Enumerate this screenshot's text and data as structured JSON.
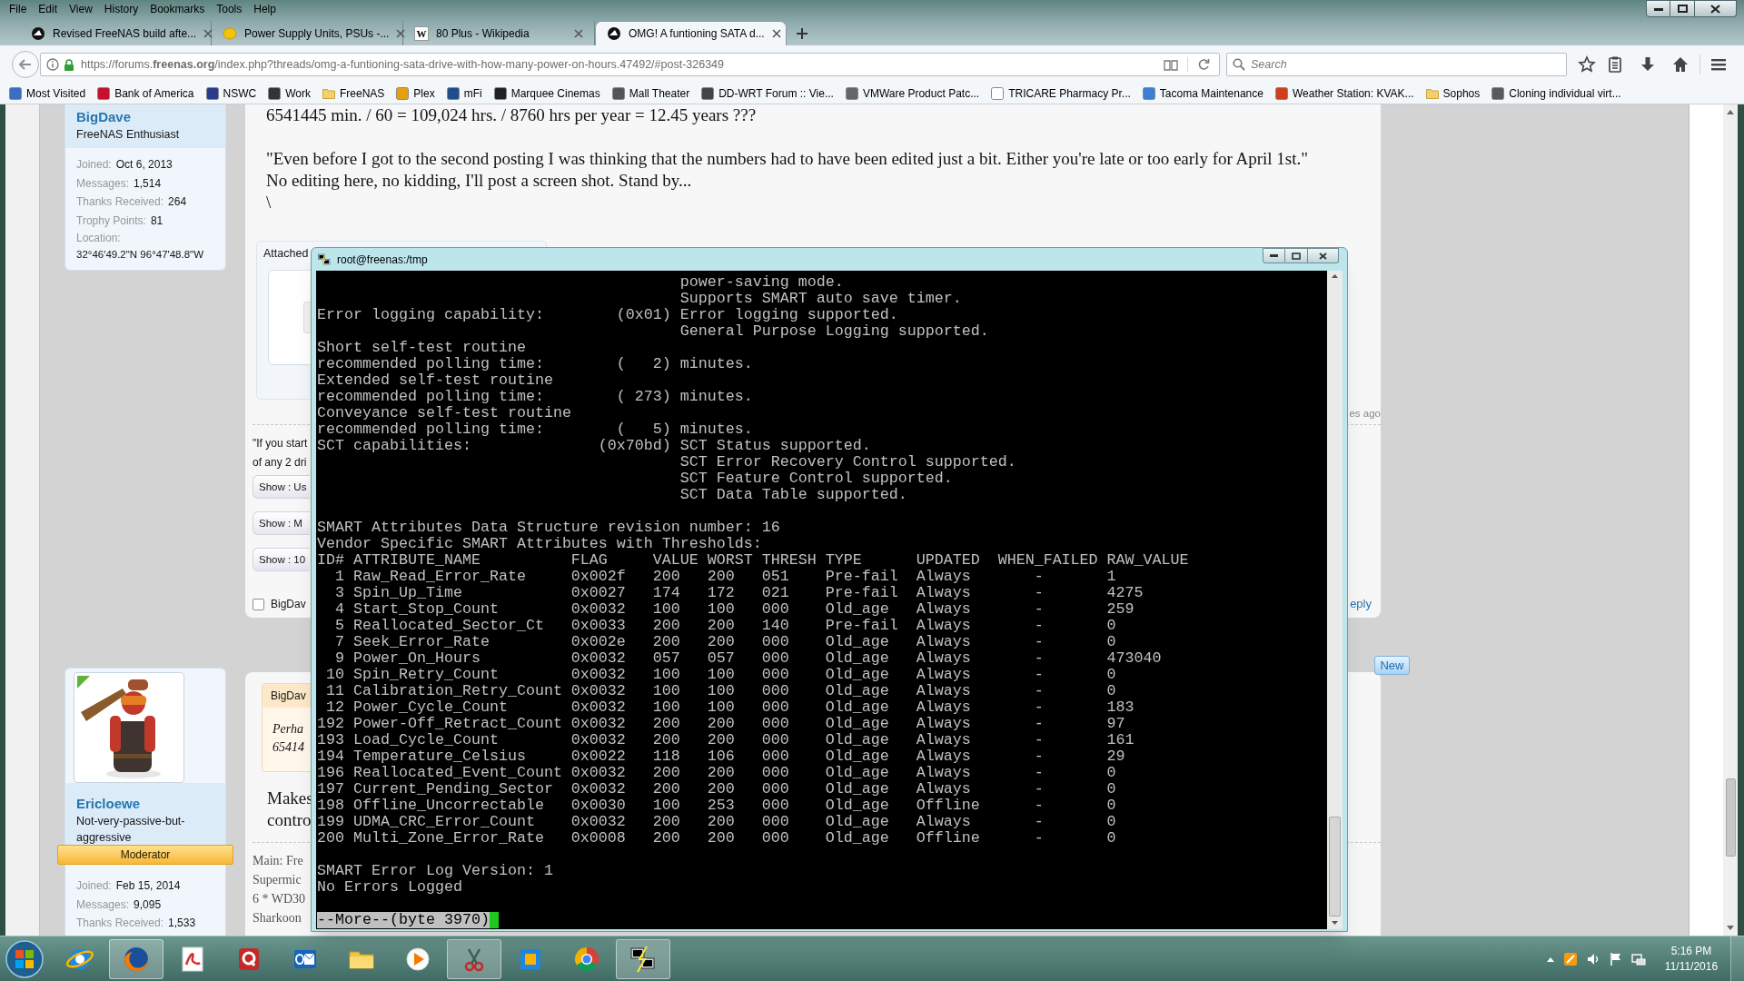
{
  "menu_bar": [
    "File",
    "Edit",
    "View",
    "History",
    "Bookmarks",
    "Tools",
    "Help"
  ],
  "tabs": [
    {
      "title": "Revised FreeNAS build afte...",
      "kind": "freenas",
      "selected": false
    },
    {
      "title": "Power Supply Units, PSUs -...",
      "kind": "coin",
      "selected": false
    },
    {
      "title": "80 Plus - Wikipedia",
      "kind": "letter",
      "icon_text": "W",
      "selected": false
    },
    {
      "title": "OMG! A funtioning SATA d...",
      "kind": "freenas",
      "selected": true
    }
  ],
  "address_bar": {
    "url": "https://forums.**freenas.org**/index.php?threads/omg-a-funtioning-sata-drive-with-how-many-power-on-hours.47492/#post-326349"
  },
  "search_field": {
    "placeholder": "Search"
  },
  "bookmarks": [
    {
      "label": "Most Visited",
      "kind": "tile",
      "color": "#3b6fc4"
    },
    {
      "label": "Bank of America",
      "kind": "tile",
      "color": "#c8102e"
    },
    {
      "label": "NSWC",
      "kind": "tile",
      "color": "#2a3a8c"
    },
    {
      "label": "Work",
      "kind": "tile",
      "color": "#333333"
    },
    {
      "label": "FreeNAS",
      "kind": "folder"
    },
    {
      "label": "Plex",
      "kind": "tile",
      "color": "#e5a00d"
    },
    {
      "label": "mFi",
      "kind": "tile",
      "color": "#1f4e8c"
    },
    {
      "label": "Marquee Cinemas",
      "kind": "tile",
      "color": "#222222"
    },
    {
      "label": "Mall Theater",
      "kind": "tile",
      "color": "#555555"
    },
    {
      "label": "DD-WRT Forum :: Vie...",
      "kind": "tile",
      "color": "#444444"
    },
    {
      "label": "VMWare Product Patc...",
      "kind": "tile",
      "color": "#666666"
    },
    {
      "label": "TRICARE Pharmacy Pr...",
      "kind": "tile",
      "color": "#ffffff"
    },
    {
      "label": "Tacoma Maintenance",
      "kind": "tile",
      "color": "#3a7fd5"
    },
    {
      "label": "Weather Station: KVAK...",
      "kind": "tile",
      "color": "#d13f1a"
    },
    {
      "label": "Sophos",
      "kind": "folder"
    },
    {
      "label": "Cloning individual virt...",
      "kind": "tile",
      "color": "#5a5a5a"
    }
  ],
  "posts": [
    {
      "author": {
        "name": "BigDave",
        "title": "FreeNAS Enthusiast",
        "stats": [
          {
            "label": "Joined:",
            "value": "Oct 6, 2013"
          },
          {
            "label": "Messages:",
            "value": "1,514"
          },
          {
            "label": "Thanks Received:",
            "value": "264"
          },
          {
            "label": "Trophy Points:",
            "value": "81"
          }
        ],
        "location": {
          "label": "Location:",
          "value": "32°46'49.2\"N 96°47'48.8\"W"
        }
      },
      "body": [
        "6541445 min. / 60 = 109,024 hrs. / 8760 hrs per year = 12.45 years ???",
        "\"Even before I got to the second posting I was thinking that the numbers had to have been edited just a bit. Either you're late or too early for April 1st.\"",
        "No editing here, no kidding, I'll post a screen shot. Stand by...",
        "\\"
      ],
      "attachments_label": "Attached",
      "time": "es ago",
      "signature": [
        "\"If you start",
        "of any 2 dri"
      ],
      "spoiler_buttons": [
        "Show : Us",
        "Show : M",
        "Show : 10"
      ],
      "like_checkbox": {
        "label": "BigDav",
        "checked": false
      },
      "reply": "eply"
    },
    {
      "author": {
        "name": "Ericloewe",
        "title": "Not-very-passive-but-aggressive",
        "avatar": {
          "kind": "picture",
          "online": true
        },
        "banner": "Moderator",
        "stats": [
          {
            "label": "Joined:",
            "value": "Feb 15, 2014"
          },
          {
            "label": "Messages:",
            "value": "9,095"
          },
          {
            "label": "Thanks Received:",
            "value": "1,533"
          }
        ]
      },
      "quote": {
        "author": "BigDav",
        "lines": [
          "Perha",
          "65414"
        ]
      },
      "body": [
        "Makes",
        "contro"
      ],
      "signature": [
        "Main: Fre",
        "Supermic",
        "6 * WD30",
        "Sharkoon"
      ],
      "new_badge": "New"
    }
  ],
  "terminal": {
    "title": "root@freenas:/tmp",
    "blocks": [
      [
        "                                        power-saving mode.",
        "                                        Supports SMART auto save timer.",
        "Error logging capability:        (0x01) Error logging supported.",
        "                                        General Purpose Logging supported.",
        "Short self-test routine",
        "recommended polling time:        (   2) minutes.",
        "Extended self-test routine",
        "recommended polling time:        ( 273) minutes.",
        "Conveyance self-test routine",
        "recommended polling time:        (   5) minutes.",
        "SCT capabilities:              (0x70bd) SCT Status supported.",
        "                                        SCT Error Recovery Control supported.",
        "                                        SCT Feature Control supported.",
        "                                        SCT Data Table supported."
      ],
      [
        "SMART Attributes Data Structure revision number: 16",
        "Vendor Specific SMART Attributes with Thresholds:",
        "ID# ATTRIBUTE_NAME          FLAG     VALUE WORST THRESH TYPE      UPDATED  WHEN_FAILED RAW_VALUE",
        "  1 Raw_Read_Error_Rate     0x002f   200   200   051    Pre-fail  Always       -       1",
        "  3 Spin_Up_Time            0x0027   174   172   021    Pre-fail  Always       -       4275",
        "  4 Start_Stop_Count        0x0032   100   100   000    Old_age   Always       -       259",
        "  5 Reallocated_Sector_Ct   0x0033   200   200   140    Pre-fail  Always       -       0",
        "  7 Seek_Error_Rate         0x002e   200   200   000    Old_age   Always       -       0",
        "  9 Power_On_Hours          0x0032   057   057   000    Old_age   Always       -       473040",
        " 10 Spin_Retry_Count        0x0032   100   100   000    Old_age   Always       -       0",
        " 11 Calibration_Retry_Count 0x0032   100   100   000    Old_age   Always       -       0",
        " 12 Power_Cycle_Count       0x0032   100   100   000    Old_age   Always       -       183",
        "192 Power-Off_Retract_Count 0x0032   200   200   000    Old_age   Always       -       97",
        "193 Load_Cycle_Count        0x0032   200   200   000    Old_age   Always       -       161",
        "194 Temperature_Celsius     0x0022   118   106   000    Old_age   Always       -       29",
        "196 Reallocated_Event_Count 0x0032   200   200   000    Old_age   Always       -       0",
        "197 Current_Pending_Sector  0x0032   200   200   000    Old_age   Always       -       0",
        "198 Offline_Uncorrectable   0x0030   100   253   000    Old_age   Offline      -       0",
        "199 UDMA_CRC_Error_Count    0x0032   200   200   000    Old_age   Always       -       0",
        "200 Multi_Zone_Error_Rate   0x0008   200   200   000    Old_age   Offline      -       0"
      ],
      [
        "SMART Error Log Version: 1",
        "No Errors Logged"
      ]
    ],
    "pager": "--More--(byte 3970)"
  },
  "taskbar": {
    "apps": [
      {
        "kind": "ie",
        "active": false
      },
      {
        "kind": "firefox",
        "active": true
      },
      {
        "kind": "pdf",
        "active": false
      },
      {
        "kind": "q",
        "active": false
      },
      {
        "kind": "outlook",
        "active": false
      },
      {
        "kind": "folder",
        "active": false
      },
      {
        "kind": "player",
        "active": false
      },
      {
        "kind": "snip",
        "active": true
      },
      {
        "kind": "lync",
        "active": false
      },
      {
        "kind": "chrome",
        "active": false
      },
      {
        "kind": "putty",
        "active": true
      }
    ],
    "time": "5:16 PM",
    "date": "11/11/2016"
  }
}
